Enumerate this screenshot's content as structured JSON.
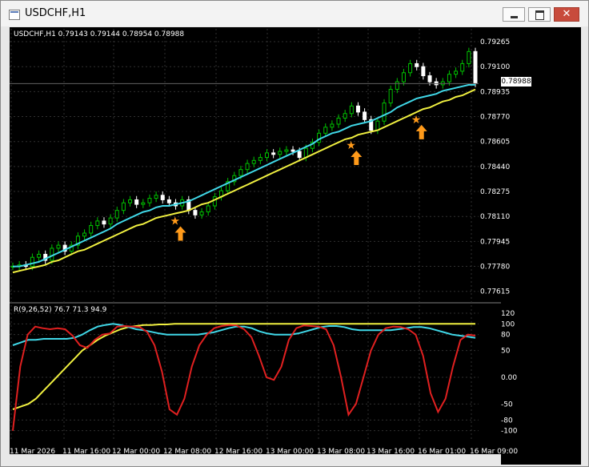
{
  "window": {
    "title": "USDCHF,H1",
    "close_glyph": "✕"
  },
  "chart_info": {
    "symbol_line": "USDCHF,H1  0.79143 0.79144 0.78954 0.78988",
    "indicator_line": "R(9,26,52) 76.7 71.3 94.9",
    "current_price": "0.78988"
  },
  "y_axis_main": [
    "0.79265",
    "0.79100",
    "0.78935",
    "0.78770",
    "0.78605",
    "0.78440",
    "0.78275",
    "0.78110",
    "0.77945",
    "0.77780",
    "0.77615"
  ],
  "y_axis_ind": [
    "120",
    "100",
    "80",
    "50",
    "0.00",
    "-50",
    "-80",
    "-100"
  ],
  "x_axis": [
    "11 Mar 2026",
    "11 Mar 16:00",
    "12 Mar 00:00",
    "12 Mar 08:00",
    "12 Mar 16:00",
    "13 Mar 00:00",
    "13 Mar 08:00",
    "13 Mar 16:00",
    "16 Mar 01:00",
    "16 Mar 09:00"
  ],
  "colors": {
    "bg": "#000000",
    "bull": "#00c000",
    "bear": "#ffffff",
    "ma_fast": "#40d8e8",
    "ma_slow": "#f0f040",
    "osc": "#e02020",
    "osc_ma": "#40d8e8",
    "osc_slow": "#f0f040",
    "arrow": "#ff9a1a"
  },
  "chart_data": {
    "type": "line",
    "price_ylim": [
      0.7755,
      0.7935
    ],
    "ind_ylim": [
      -120,
      135
    ],
    "close": [
      0.7778,
      0.7779,
      0.7778,
      0.7784,
      0.7786,
      0.7782,
      0.779,
      0.7792,
      0.7788,
      0.7792,
      0.7798,
      0.78,
      0.7805,
      0.7808,
      0.7806,
      0.781,
      0.7815,
      0.782,
      0.7822,
      0.7819,
      0.782,
      0.7823,
      0.7825,
      0.7822,
      0.782,
      0.7818,
      0.7822,
      0.7815,
      0.7812,
      0.7814,
      0.7818,
      0.7824,
      0.7828,
      0.7834,
      0.7838,
      0.7842,
      0.7846,
      0.7848,
      0.785,
      0.7853,
      0.7852,
      0.7854,
      0.7855,
      0.7854,
      0.785,
      0.7856,
      0.786,
      0.7866,
      0.787,
      0.7872,
      0.7876,
      0.7879,
      0.7884,
      0.788,
      0.7875,
      0.7868,
      0.7874,
      0.7886,
      0.7895,
      0.79,
      0.7906,
      0.7912,
      0.791,
      0.7904,
      0.79,
      0.7898,
      0.79,
      0.7905,
      0.7907,
      0.7912,
      0.792,
      0.7899
    ],
    "ma_fast": [
      0.7778,
      0.7778,
      0.7779,
      0.778,
      0.7781,
      0.7783,
      0.7785,
      0.7787,
      0.7789,
      0.7791,
      0.7793,
      0.7795,
      0.7797,
      0.7799,
      0.7801,
      0.7803,
      0.7806,
      0.7808,
      0.781,
      0.7812,
      0.7814,
      0.7815,
      0.7817,
      0.7818,
      0.7818,
      0.7819,
      0.782,
      0.7821,
      0.7823,
      0.7825,
      0.7827,
      0.7829,
      0.7831,
      0.7833,
      0.7835,
      0.7837,
      0.7839,
      0.7841,
      0.7843,
      0.7845,
      0.7847,
      0.7849,
      0.7851,
      0.7853,
      0.7855,
      0.7857,
      0.7859,
      0.7862,
      0.7864,
      0.7866,
      0.7867,
      0.7869,
      0.7871,
      0.7872,
      0.7873,
      0.7874,
      0.7876,
      0.7878,
      0.788,
      0.7883,
      0.7885,
      0.7887,
      0.7889,
      0.789,
      0.7891,
      0.7892,
      0.7894,
      0.7895,
      0.7896,
      0.7897,
      0.7898,
      0.7898
    ],
    "ma_slow": [
      0.7774,
      0.7775,
      0.7776,
      0.7777,
      0.7778,
      0.7779,
      0.7781,
      0.7782,
      0.7784,
      0.7786,
      0.7788,
      0.7789,
      0.7791,
      0.7793,
      0.7795,
      0.7797,
      0.7799,
      0.7801,
      0.7803,
      0.7805,
      0.7806,
      0.7808,
      0.781,
      0.7811,
      0.7812,
      0.7813,
      0.7814,
      0.7815,
      0.7817,
      0.7819,
      0.782,
      0.7822,
      0.7824,
      0.7826,
      0.7828,
      0.783,
      0.7832,
      0.7834,
      0.7836,
      0.7838,
      0.784,
      0.7842,
      0.7844,
      0.7846,
      0.7848,
      0.785,
      0.7852,
      0.7854,
      0.7856,
      0.7858,
      0.786,
      0.7862,
      0.7863,
      0.7865,
      0.7866,
      0.7867,
      0.7868,
      0.787,
      0.7872,
      0.7874,
      0.7876,
      0.7878,
      0.788,
      0.7882,
      0.7883,
      0.7885,
      0.7887,
      0.7888,
      0.789,
      0.7891,
      0.7893,
      0.7895
    ],
    "osc_red": [
      -100,
      20,
      80,
      95,
      92,
      90,
      92,
      90,
      78,
      60,
      55,
      70,
      80,
      82,
      95,
      96,
      95,
      94,
      85,
      60,
      10,
      -60,
      -70,
      -40,
      20,
      60,
      80,
      92,
      96,
      98,
      97,
      90,
      75,
      40,
      0,
      -5,
      20,
      70,
      92,
      97,
      96,
      95,
      90,
      60,
      0,
      -70,
      -50,
      0,
      50,
      80,
      92,
      95,
      94,
      90,
      80,
      40,
      -30,
      -65,
      -40,
      20,
      70,
      80,
      78
    ],
    "osc_cyan": [
      60,
      65,
      70,
      70,
      72,
      72,
      72,
      72,
      74,
      80,
      88,
      95,
      98,
      100,
      98,
      94,
      90,
      88,
      85,
      82,
      80,
      80,
      80,
      80,
      80,
      82,
      84,
      88,
      92,
      95,
      95,
      92,
      86,
      82,
      80,
      80,
      80,
      82,
      86,
      90,
      94,
      96,
      96,
      94,
      90,
      88,
      88,
      88,
      88,
      88,
      90,
      92,
      94,
      94,
      92,
      88,
      84,
      80,
      78,
      76,
      74
    ],
    "osc_yellow": [
      -60,
      -55,
      -50,
      -40,
      -25,
      -10,
      5,
      20,
      35,
      50,
      60,
      70,
      78,
      84,
      90,
      94,
      96,
      98,
      98,
      99,
      99,
      100,
      100,
      100,
      100,
      100,
      100,
      100,
      100,
      100,
      100,
      100,
      100,
      100,
      100,
      100,
      100,
      100,
      100,
      100,
      100,
      100,
      100,
      100,
      100,
      100,
      100,
      100,
      100,
      100,
      100,
      100,
      100,
      100,
      100,
      100,
      100,
      100,
      100,
      100,
      100
    ],
    "arrows_at_index": [
      25,
      52,
      62
    ]
  }
}
